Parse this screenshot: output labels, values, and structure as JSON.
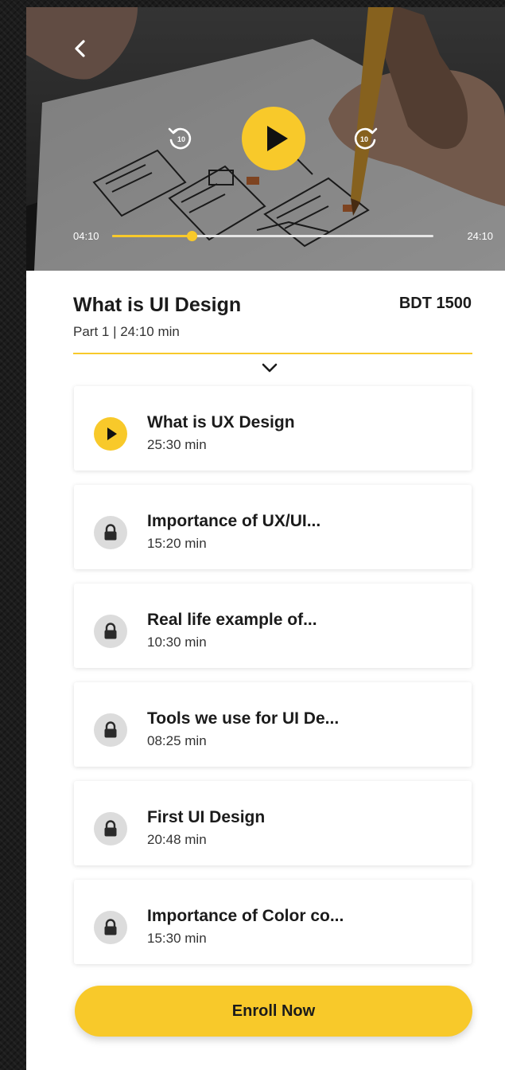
{
  "player": {
    "current_time": "04:10",
    "total_time": "24:10",
    "progress": 0.247,
    "skip_back_seconds": "10",
    "skip_forward_seconds": "10"
  },
  "course": {
    "title": "What is UI Design",
    "price": "BDT 1500",
    "meta": "Part 1  |  24:10 min"
  },
  "lessons": [
    {
      "title": "What is UX Design",
      "duration": "25:30 min",
      "state": "playing",
      "icon": "play-icon"
    },
    {
      "title": "Importance of UX/UI...",
      "duration": "15:20 min",
      "state": "locked",
      "icon": "lock-icon"
    },
    {
      "title": "Real life example of...",
      "duration": "10:30 min",
      "state": "locked",
      "icon": "lock-icon"
    },
    {
      "title": "Tools we use for UI De...",
      "duration": "08:25 min",
      "state": "locked",
      "icon": "lock-icon"
    },
    {
      "title": "First UI Design",
      "duration": "20:48 min",
      "state": "locked",
      "icon": "lock-icon"
    },
    {
      "title": "Importance of Color co...",
      "duration": "15:30 min",
      "state": "locked",
      "icon": "lock-icon"
    }
  ],
  "enroll": {
    "label": "Enroll Now"
  },
  "colors": {
    "accent": "#f8c92a",
    "locked_icon_bg": "#dcdcdc",
    "text": "#1b1b1b"
  }
}
